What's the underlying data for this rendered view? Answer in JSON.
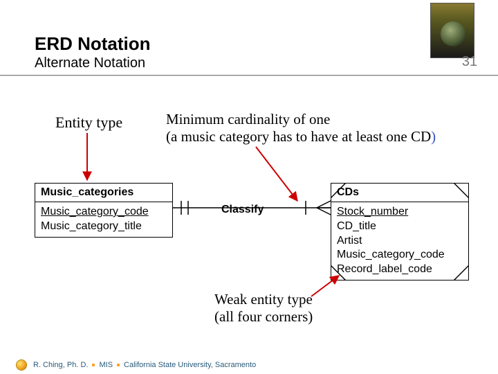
{
  "title": "ERD Notation",
  "subtitle": "Alternate Notation",
  "page": "31",
  "labels": {
    "entity_type": "Entity type",
    "min_card_l1": "Minimum cardinality of one",
    "min_card_l2a": "(a music category has to have at least one CD",
    "min_card_l2b": ")",
    "weak_l1": "Weak entity type",
    "weak_l2": "(all four corners)"
  },
  "relationship": "Classify",
  "entities": [
    {
      "name": "Music_categories",
      "attrs": [
        "Music_category_code",
        "Music_category_title"
      ]
    },
    {
      "name": "CDs",
      "weak": true,
      "attrs": [
        "Stock_number",
        "CD_title",
        "Artist",
        "Music_category_code",
        "Record_label_code"
      ]
    }
  ],
  "footer": {
    "author": "R. Ching, Ph. D.",
    "dept": "MIS",
    "school": "California State University, Sacramento"
  },
  "chart_data": {
    "type": "erd",
    "notation": "alternate (Information Engineering style)",
    "entities": [
      {
        "name": "Music_categories",
        "pk": [
          "Music_category_code"
        ],
        "attributes": [
          "Music_category_code",
          "Music_category_title"
        ],
        "weak": false
      },
      {
        "name": "CDs",
        "pk": [
          "Stock_number"
        ],
        "attributes": [
          "Stock_number",
          "CD_title",
          "Artist",
          "Music_category_code",
          "Record_label_code"
        ],
        "weak": true
      }
    ],
    "relationships": [
      {
        "name": "Classify",
        "from": "Music_categories",
        "from_cardinality": "1..1",
        "to": "CDs",
        "to_cardinality": "1..N",
        "note": "a music category has to have at least one CD"
      }
    ],
    "annotations": [
      {
        "text": "Entity type",
        "points_to": "Music_categories"
      },
      {
        "text": "Minimum cardinality of one",
        "points_to": "Classify (CDs side min=1)"
      },
      {
        "text": "Weak entity type (all four corners)",
        "points_to": "CDs"
      }
    ]
  }
}
